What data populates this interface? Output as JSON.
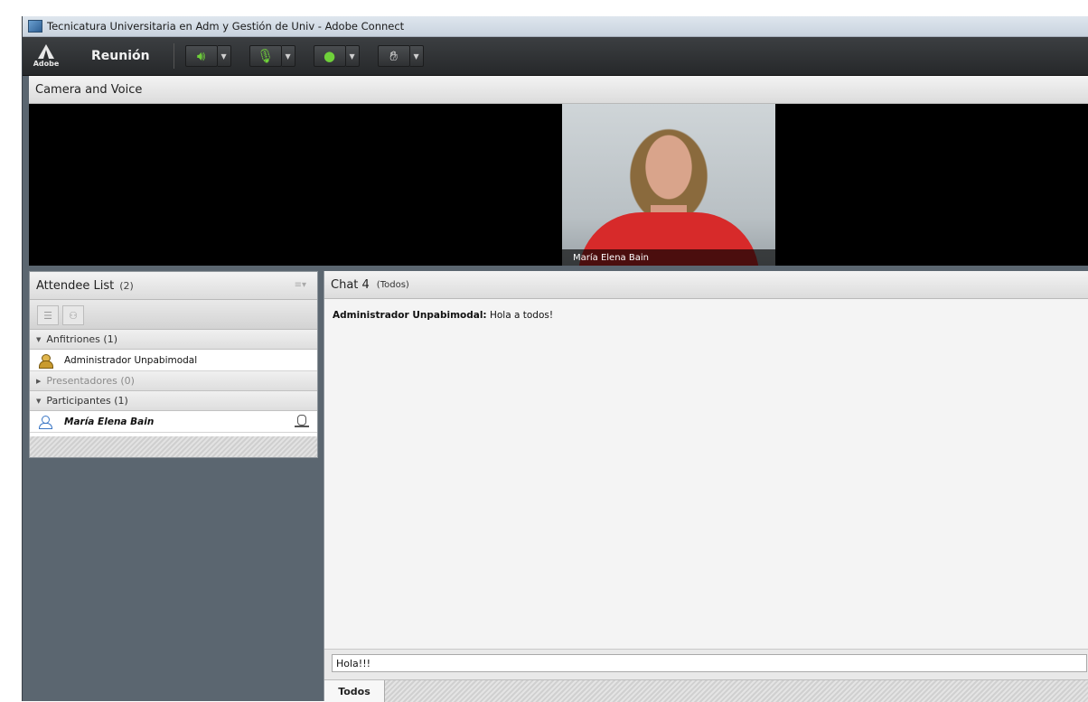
{
  "window": {
    "title": "Tecnicatura Universitaria en Adm y Gestión de Univ - Adobe Connect"
  },
  "menubar": {
    "logo_text": "Adobe",
    "meeting_label": "Reunión",
    "tools": [
      "speaker-icon",
      "microphone-icon",
      "webcam-icon",
      "raise-hand-icon"
    ]
  },
  "camera_pod": {
    "title": "Camera and Voice",
    "video_name": "María Elena Bain"
  },
  "attendee_pod": {
    "title": "Attendee List",
    "count": "(2)",
    "groups": [
      {
        "label": "Anfitriones (1)",
        "expanded": true,
        "members": [
          "Administrador Unpabimodal"
        ]
      },
      {
        "label": "Presentadores (0)",
        "expanded": false,
        "members": []
      },
      {
        "label": "Participantes (1)",
        "expanded": true,
        "members": [
          "María Elena Bain"
        ]
      }
    ]
  },
  "chat_pod": {
    "title": "Chat 4",
    "subtitle": "(Todos)",
    "messages": [
      {
        "sender": "Administrador Unpabimodal:",
        "text": "Hola a todos!"
      }
    ],
    "input_value": "Hola!!!",
    "tab_label": "Todos"
  },
  "colors": {
    "toolbar_green": "#6fd13a",
    "shirt_red": "#d72a2a",
    "background_gray": "#5b6670"
  }
}
